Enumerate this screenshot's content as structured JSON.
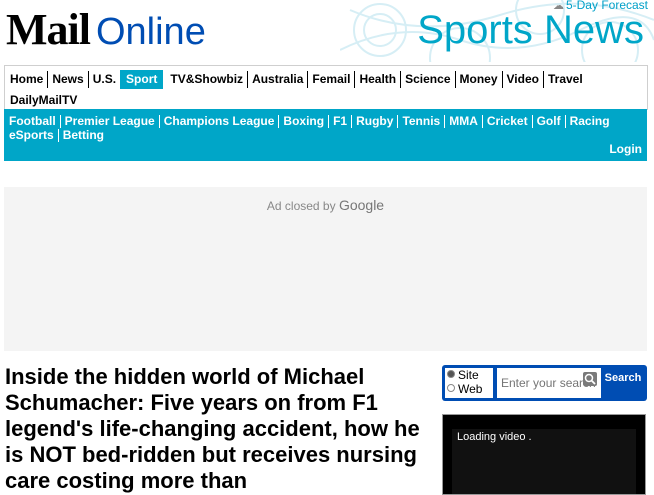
{
  "masthead": {
    "logo_part1": "Mail",
    "logo_part2": "Online",
    "forecast_label": "5-Day Forecast",
    "section_title": "Sports News"
  },
  "main_nav": {
    "row1": [
      "Home",
      "News",
      "U.S.",
      "Sport",
      "TV&Showbiz",
      "Australia",
      "Femail",
      "Health",
      "Science",
      "Money",
      "Video",
      "Travel"
    ],
    "row2": [
      "DailyMailTV"
    ],
    "active": "Sport"
  },
  "sub_nav": {
    "row1": [
      "Football",
      "Premier League",
      "Champions League",
      "Boxing",
      "F1",
      "Rugby",
      "Tennis",
      "MMA",
      "Cricket",
      "Golf",
      "Racing"
    ],
    "row2": [
      "eSports",
      "Betting"
    ],
    "login": "Login"
  },
  "ad": {
    "closed_text": "Ad closed by",
    "brand": "Google"
  },
  "article": {
    "headline": "Inside the hidden world of Michael Schumacher: Five years on from F1 legend's life-changing accident, how he is NOT bed-ridden but receives nursing care costing more than"
  },
  "search": {
    "option_site": "Site",
    "option_web": "Web",
    "selected": "Site",
    "placeholder": "Enter your search",
    "button_label": "Search"
  },
  "video": {
    "status": "Loading video ."
  },
  "colors": {
    "sport_accent": "#00a6c8",
    "brand_blue": "#004db3"
  }
}
